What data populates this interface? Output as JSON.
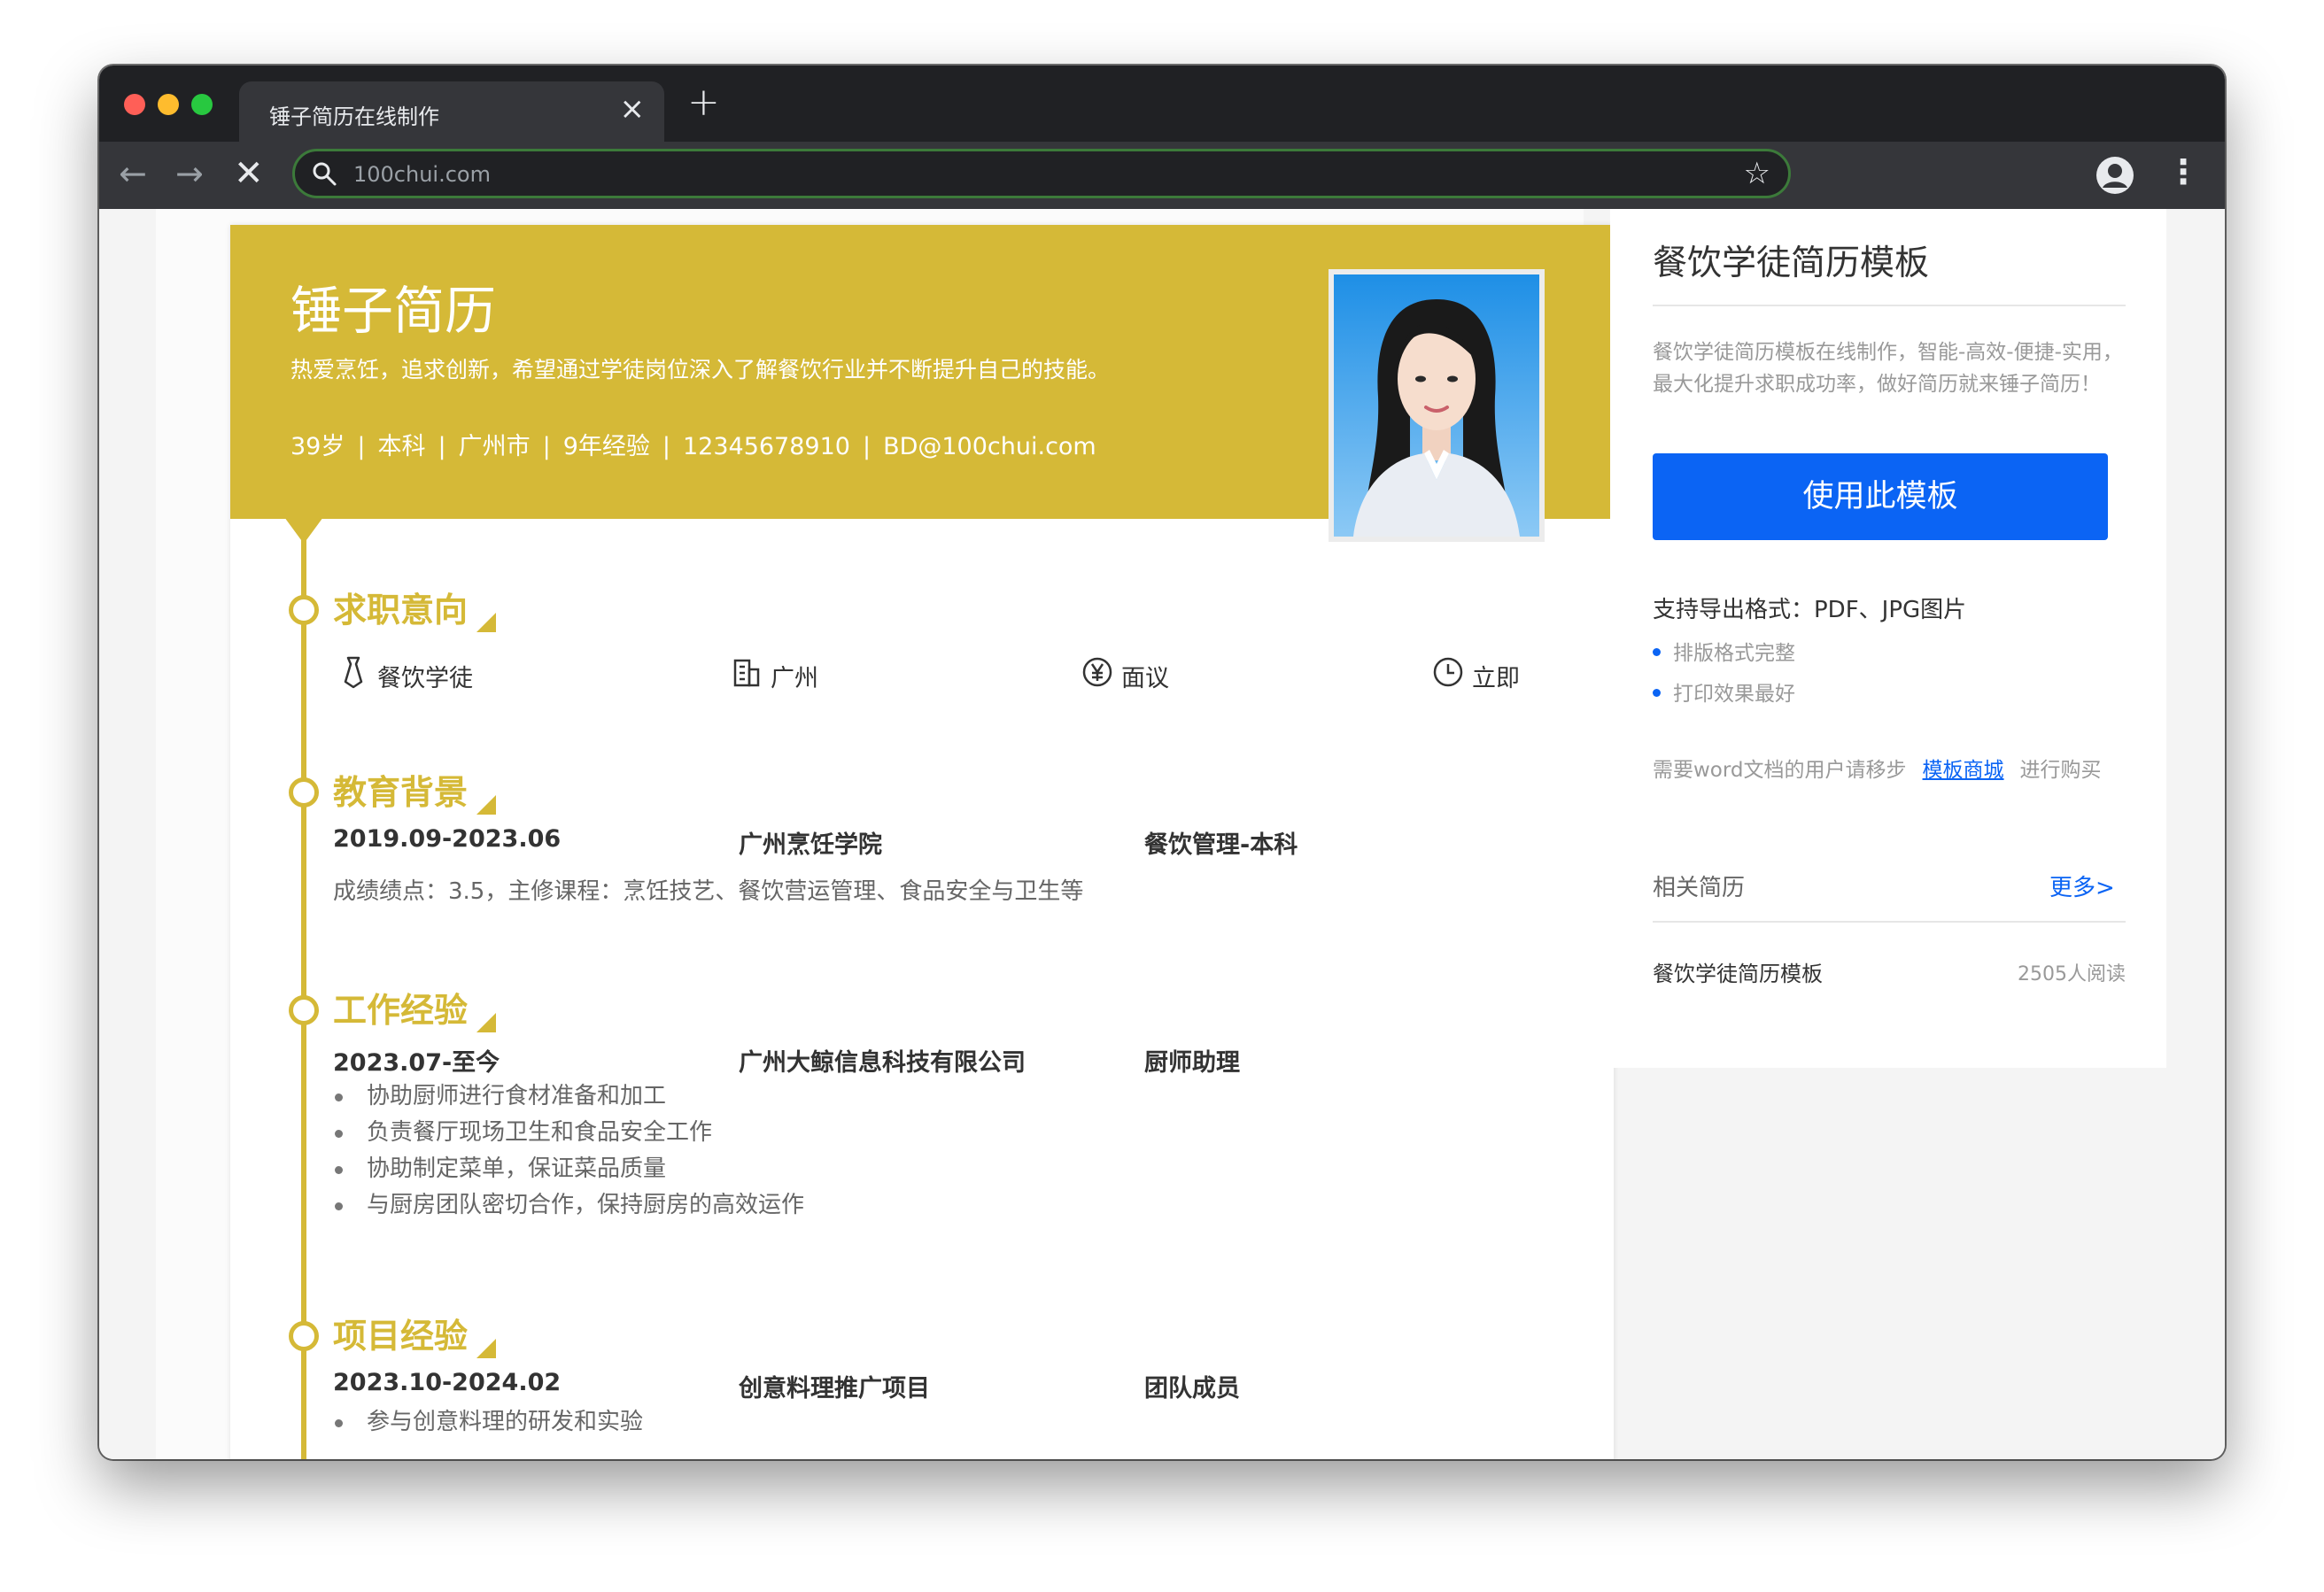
{
  "browser": {
    "tab_title": "锤子简历在线制作",
    "url": "100chui.com"
  },
  "resume": {
    "name": "锤子简历",
    "slogan": "热爱烹饪，追求创新，希望通过学徒岗位深入了解餐饮行业并不断提升自己的技能。",
    "info": {
      "age": "39岁",
      "degree": "本科",
      "city": "广州市",
      "experience": "9年经验",
      "phone": "12345678910",
      "email": "BD@100chui.com"
    },
    "intent": {
      "title": "求职意向",
      "position": "餐饮学徒",
      "location": "广州",
      "salary": "面议",
      "availability": "立即"
    },
    "education": {
      "title": "教育背景",
      "period": "2019.09-2023.06",
      "school": "广州烹饪学院",
      "major": "餐饮管理-本科",
      "detail": "成绩绩点：3.5，主修课程：烹饪技艺、餐饮营运管理、食品安全与卫生等"
    },
    "work": {
      "title": "工作经验",
      "period": "2023.07-至今",
      "company": "广州大鲸信息科技有限公司",
      "role": "厨师助理",
      "duties": [
        "协助厨师进行食材准备和加工",
        "负责餐厅现场卫生和食品安全工作",
        "协助制定菜单，保证菜品质量",
        "与厨房团队密切合作，保持厨房的高效运作"
      ]
    },
    "project": {
      "title": "项目经验",
      "period": "2023.10-2024.02",
      "name": "创意料理推广项目",
      "role": "团队成员",
      "duties": [
        "参与创意料理的研发和实验"
      ]
    }
  },
  "sidebar": {
    "title": "餐饮学徒简历模板",
    "desc": "餐饮学徒简历模板在线制作，智能-高效-便捷-实用，最大化提升求职成功率，做好简历就来锤子简历！",
    "use_button": "使用此模板",
    "formats": "支持导出格式：PDF、JPG图片",
    "features": [
      "排版格式完整",
      "打印效果最好"
    ],
    "word_prefix": "需要word文档的用户请移步",
    "word_link": "模板商城",
    "word_suffix": "进行购买",
    "related_title": "相关简历",
    "more": "更多>",
    "related": [
      {
        "name": "餐饮学徒简历模板",
        "reads": "2505人阅读"
      }
    ]
  },
  "colors": {
    "accent": "#d5b937",
    "primary": "#0b64f4"
  }
}
